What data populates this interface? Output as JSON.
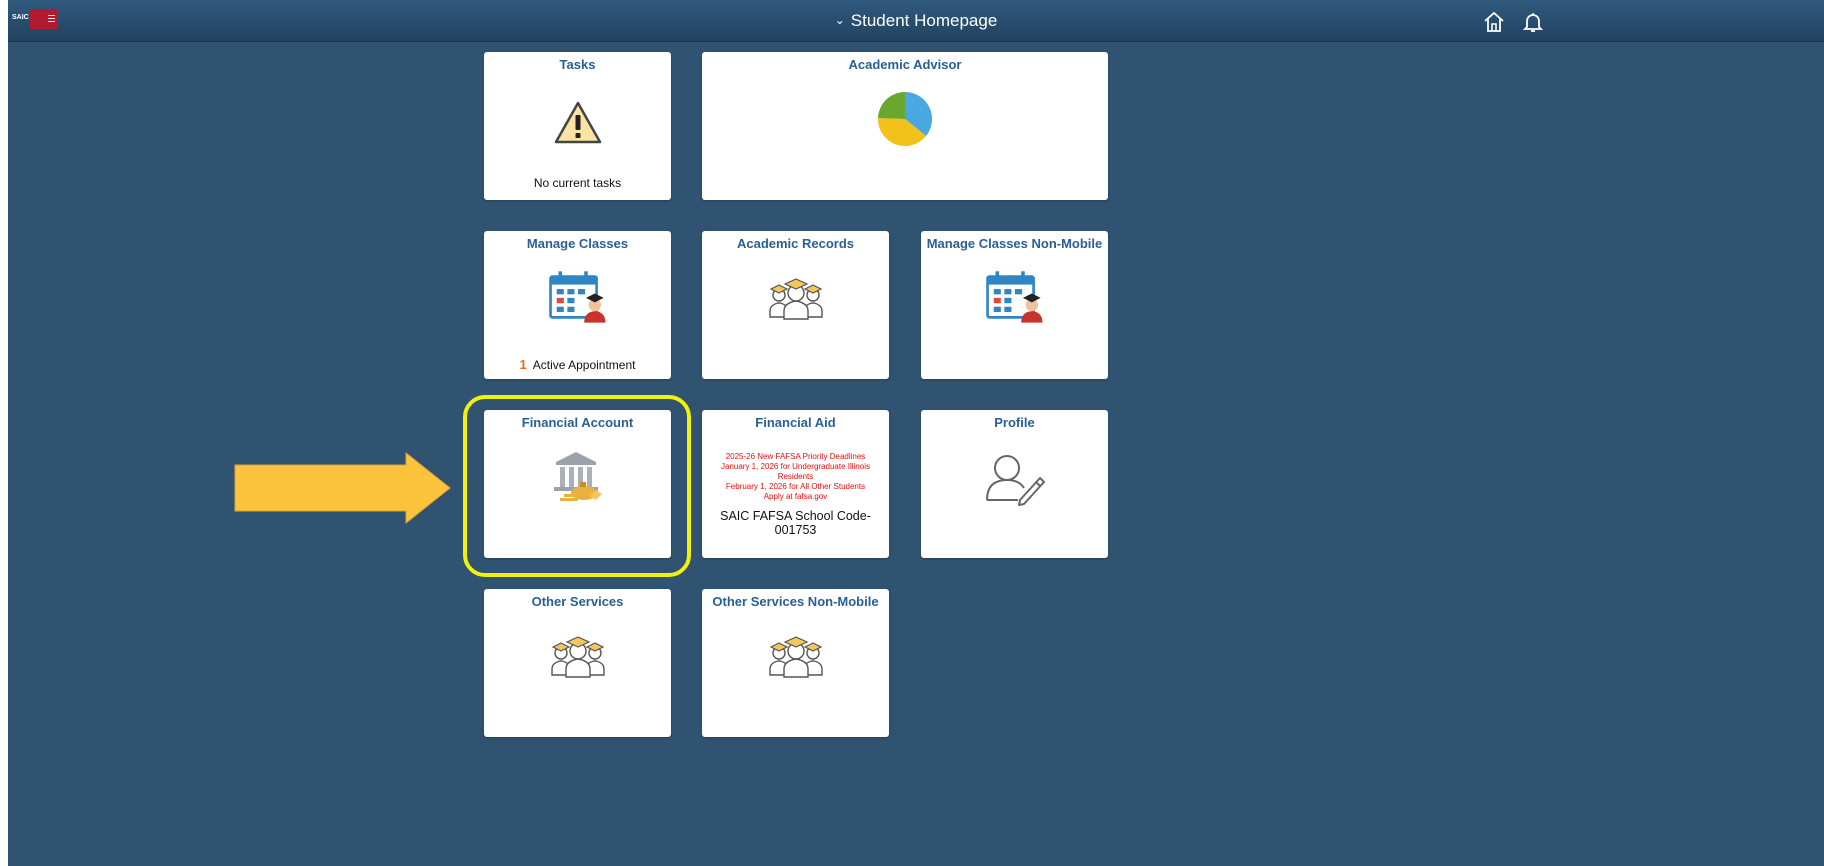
{
  "header": {
    "title": "Student Homepage",
    "logo_text": "SAIC",
    "home_icon": "home-icon",
    "bell_icon": "notification-bell-icon"
  },
  "tiles": {
    "tasks": {
      "title": "Tasks",
      "footer": "No current tasks",
      "icon": "warning-triangle-icon"
    },
    "academic_advisor": {
      "title": "Academic Advisor",
      "icon": "pie-chart-icon"
    },
    "manage_classes": {
      "title": "Manage Classes",
      "badge_count": "1",
      "footer": "Active Appointment",
      "icon": "calendar-student-icon"
    },
    "academic_records": {
      "title": "Academic Records",
      "icon": "graduates-icon"
    },
    "manage_classes_non_mobile": {
      "title": "Manage Classes Non-Mobile",
      "icon": "calendar-student-icon"
    },
    "financial_account": {
      "title": "Financial Account",
      "icon": "bank-money-icon"
    },
    "financial_aid": {
      "title": "Financial Aid",
      "message_lines": [
        "2025-26 New FAFSA Priority Deadlines",
        "January 1, 2026 for Undergraduate Illinois Residents",
        "February 1, 2026 for All Other Students",
        "Apply at fafsa.gov"
      ],
      "footer": "SAIC FAFSA School Code-001753"
    },
    "profile": {
      "title": "Profile",
      "icon": "profile-edit-icon"
    },
    "other_services": {
      "title": "Other Services",
      "icon": "graduates-icon"
    },
    "other_services_non_mobile": {
      "title": "Other Services Non-Mobile",
      "icon": "graduates-icon"
    }
  },
  "annotation": {
    "highlight_color": "#f3f00c",
    "arrow_color": "#fcc43d",
    "target_tile": "Financial Account"
  },
  "colors": {
    "background": "#2f5370",
    "tile_title": "#2a5f93",
    "alert_text": "#e01010"
  }
}
